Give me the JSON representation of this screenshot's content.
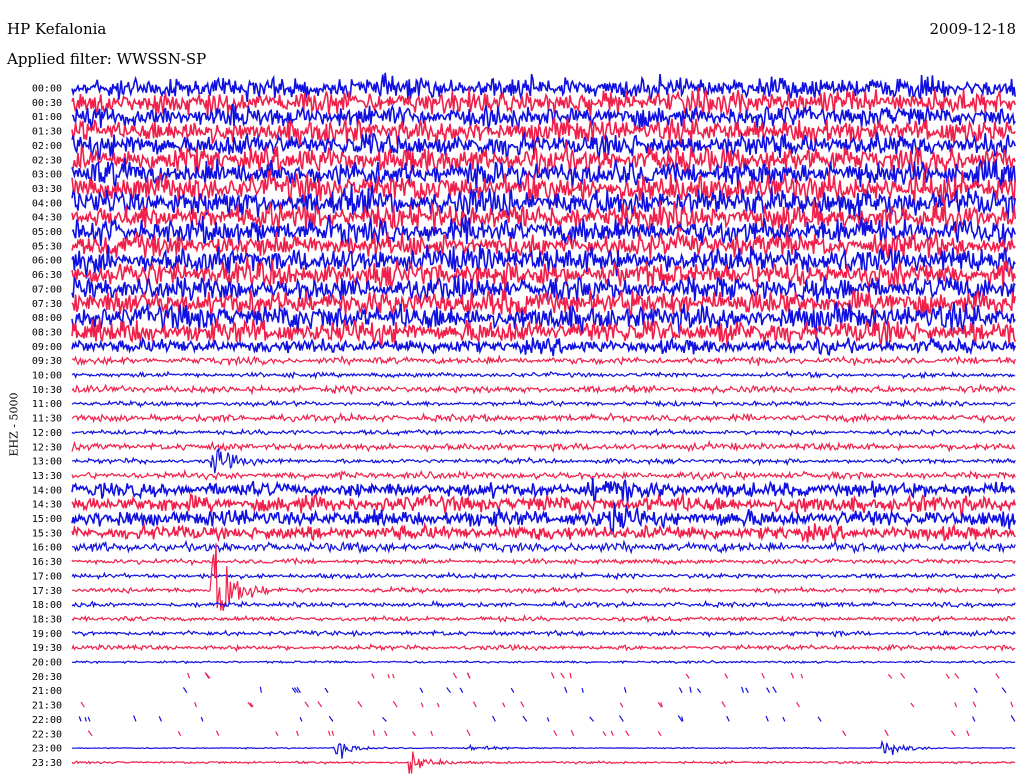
{
  "chart_data": {
    "type": "line",
    "title": "HP Kefalonia",
    "date": "2009-12-18",
    "subtitle": "Applied filter: WWSSN-SP",
    "ylabel": "EHZ - 5000",
    "row_labels": [
      "00:00",
      "00:30",
      "01:00",
      "01:30",
      "02:00",
      "02:30",
      "03:00",
      "03:30",
      "04:00",
      "04:30",
      "05:00",
      "05:30",
      "06:00",
      "06:30",
      "07:00",
      "07:30",
      "08:00",
      "08:30",
      "09:00",
      "09:30",
      "10:00",
      "10:30",
      "11:00",
      "11:30",
      "12:00",
      "12:30",
      "13:00",
      "13:30",
      "14:00",
      "14:30",
      "15:00",
      "15:30",
      "16:00",
      "16:30",
      "17:00",
      "17:30",
      "18:00",
      "18:30",
      "19:00",
      "19:30",
      "20:00",
      "20:30",
      "21:00",
      "21:30",
      "22:00",
      "22:30",
      "23:00",
      "23:30"
    ],
    "series_colors": [
      "#1010e0",
      "#f0204a"
    ],
    "row_noise_level": [
      9,
      10,
      9,
      10,
      10,
      11,
      11,
      12,
      12,
      11,
      11,
      10,
      11,
      11,
      10,
      11,
      11,
      10,
      6,
      3,
      2,
      3,
      2,
      3,
      2,
      3,
      2,
      3,
      6,
      7,
      7,
      6,
      4,
      2,
      2,
      2,
      2,
      2,
      2,
      2,
      1,
      0,
      0,
      0,
      0,
      0,
      0.5,
      1
    ],
    "events": [
      {
        "row": 26,
        "x": 0.15,
        "amplitude": 14
      },
      {
        "row": 28,
        "x": 0.55,
        "amplitude": 10
      },
      {
        "row": 28,
        "x": 0.58,
        "amplitude": 10
      },
      {
        "row": 30,
        "x": 0.57,
        "amplitude": 12
      },
      {
        "row": 35,
        "x": 0.15,
        "amplitude": 60
      },
      {
        "row": 46,
        "x": 0.28,
        "amplitude": 10
      },
      {
        "row": 46,
        "x": 0.42,
        "amplitude": 6
      },
      {
        "row": 46,
        "x": 0.86,
        "amplitude": 10
      },
      {
        "row": 47,
        "x": 0.36,
        "amplitude": 10
      }
    ]
  }
}
